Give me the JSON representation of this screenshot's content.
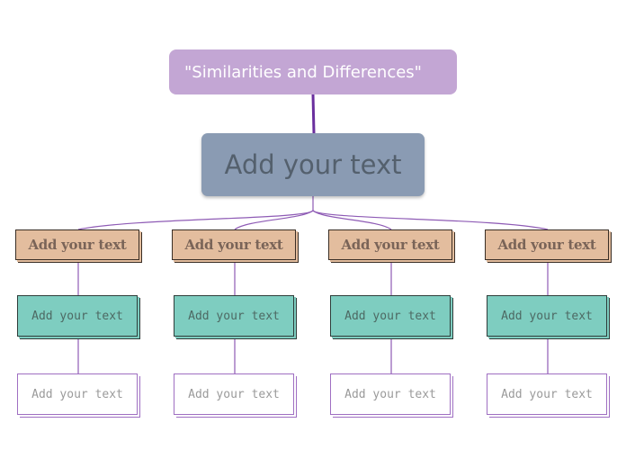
{
  "diagram": {
    "title": "\"Similarities and Differences\"",
    "main_topic": "Add your text",
    "columns": [
      {
        "category": "Add your text",
        "detail_1": "Add your text",
        "detail_2": "Add your text"
      },
      {
        "category": "Add your text",
        "detail_1": "Add your text",
        "detail_2": "Add your text"
      },
      {
        "category": "Add your text",
        "detail_1": "Add your text",
        "detail_2": "Add your text"
      },
      {
        "category": "Add your text",
        "detail_1": "Add your text",
        "detail_2": "Add your text"
      }
    ]
  },
  "colors": {
    "title_fill": "#c3a6d4",
    "main_fill": "#8a9bb3",
    "category_fill": "#e3bd9e",
    "detail_fill": "#7ecdc0",
    "connector": "#8e5bb5"
  }
}
